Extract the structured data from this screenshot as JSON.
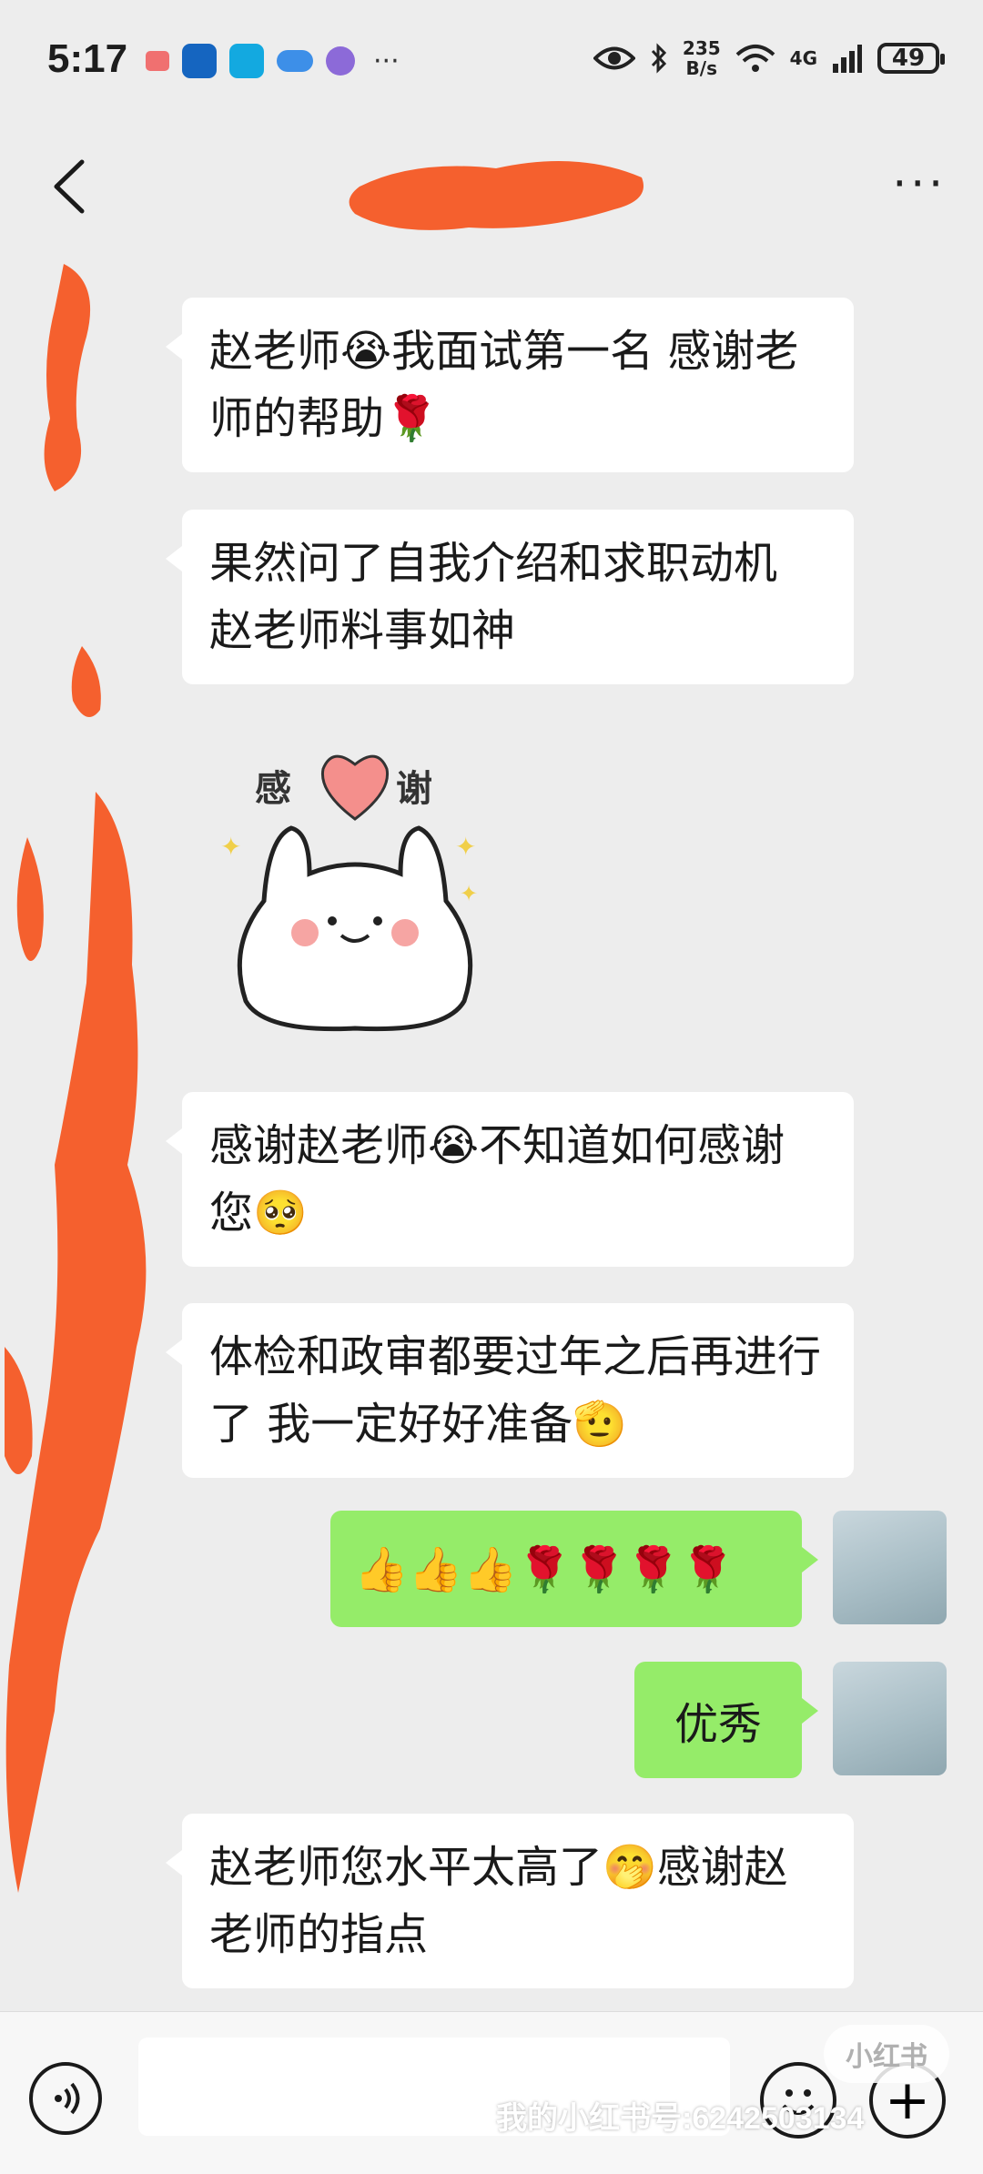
{
  "status_bar": {
    "time": "5:17",
    "net_speed_value": "235",
    "net_speed_unit": "B/s",
    "network": "4G",
    "battery": "49"
  },
  "header": {
    "back_icon": "chevron-left-icon",
    "more_icon": "more-dots-icon",
    "more_label": "···"
  },
  "messages": [
    {
      "side": "left",
      "text": "赵老师😭我面试第一名 感谢老师的帮助🌹"
    },
    {
      "side": "left",
      "text": "果然问了自我介绍和求职动机 赵老师料事如神"
    },
    {
      "side": "left",
      "sticker_text_left": "感",
      "sticker_text_right": "谢"
    },
    {
      "side": "left",
      "text": "感谢赵老师😭不知道如何感谢您🥺"
    },
    {
      "side": "left",
      "text": "体检和政审都要过年之后再进行了 我一定好好准备🫡"
    },
    {
      "side": "right",
      "text": "👍👍👍🌹🌹🌹🌹"
    },
    {
      "side": "right",
      "text": "优秀"
    },
    {
      "side": "left",
      "text": "赵老师您水平太高了🤭感谢赵老师的指点"
    }
  ],
  "input_bar": {
    "voice_icon": "voice-icon",
    "emoji_icon": "emoji-smile-icon",
    "plus_icon": "plus-icon",
    "plus_label": "+"
  },
  "watermark": {
    "text": "我的小红书号:6242503134",
    "logo_text": "小红书"
  },
  "colors": {
    "background": "#ededed",
    "bubble_left": "#ffffff",
    "bubble_right": "#95ec69",
    "redaction": "#f5602e"
  }
}
